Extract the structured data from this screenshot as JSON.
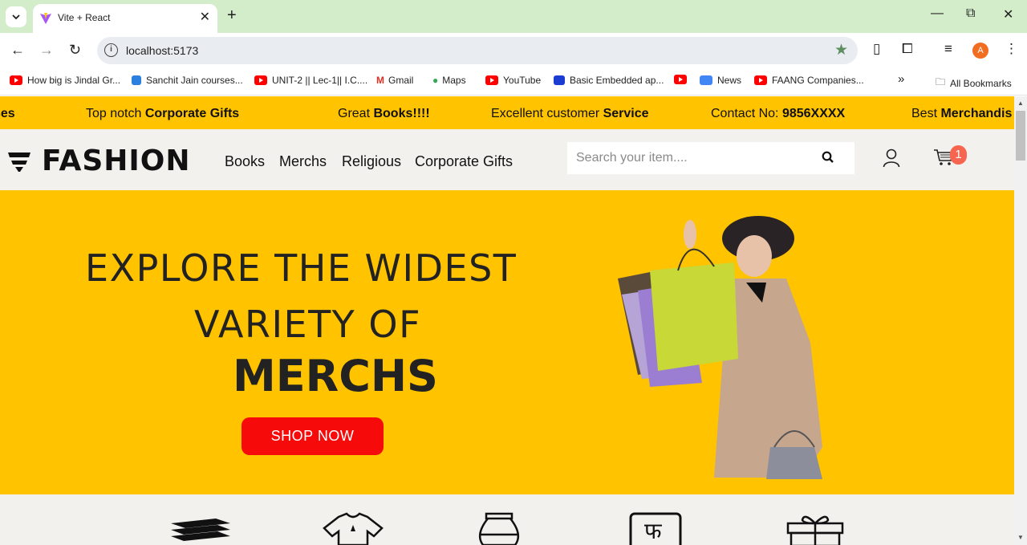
{
  "browser": {
    "tab_title": "Vite + React",
    "url": "localhost:5173",
    "bookmarks": [
      "How big is Jindal Gr...",
      "Sanchit Jain courses...",
      "UNIT-2 || Lec-1|| I.C....",
      "Gmail",
      "Maps",
      "YouTube",
      "Basic Embedded ap...",
      "",
      "News",
      "FAANG Companies..."
    ],
    "all_bookmarks": "All Bookmarks",
    "overflow": "»",
    "profile_initial": "A"
  },
  "ticker": [
    {
      "pre": "",
      "bold": "ses"
    },
    {
      "pre": "Top notch ",
      "bold": "Corporate Gifts"
    },
    {
      "pre": "Great ",
      "bold": "Books!!!!"
    },
    {
      "pre": "Excellent customer ",
      "bold": "Service"
    },
    {
      "pre": "Contact No: ",
      "bold": "9856XXXX"
    },
    {
      "pre": "Best ",
      "bold": "Merchandis"
    }
  ],
  "header": {
    "logo_text": "FASHION",
    "nav": [
      "Books",
      "Merchs",
      "Religious",
      "Corporate Gifts"
    ],
    "search_placeholder": "Search your item....",
    "cart_count": "1"
  },
  "hero": {
    "line1": "EXPLORE THE  WIDEST",
    "line2": "VARIETY OF",
    "line3": "MERCHS",
    "cta": "SHOP NOW"
  },
  "categories": [
    "books-icon",
    "tshirt-icon",
    "pot-icon",
    "hindi-letter-icon",
    "gift-icon"
  ],
  "colors": {
    "ticker_bg": "#ffc300",
    "hero_bg": "#ffc300",
    "cta_bg": "#f70a0a",
    "badge_bg": "#f6654f",
    "tabbar_bg": "#d3ecc9"
  }
}
